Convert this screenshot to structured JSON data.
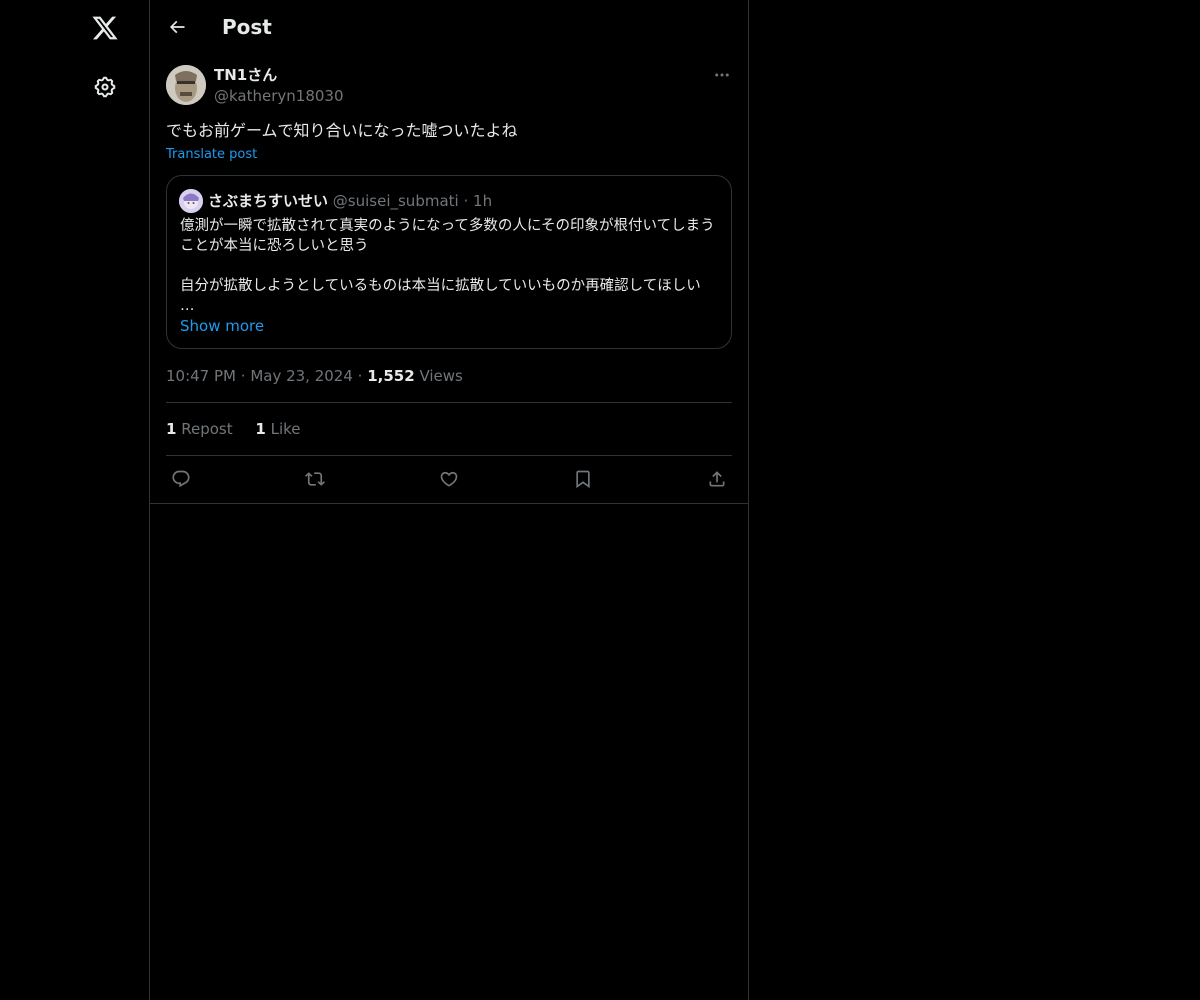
{
  "header": {
    "title": "Post"
  },
  "sidebar": {
    "items": [
      {
        "icon": "x-logo-icon"
      },
      {
        "icon": "gear-icon"
      }
    ]
  },
  "post": {
    "author_name": "TN1さん",
    "author_handle": "@katheryn18030",
    "text": "でもお前ゲームで知り合いになった嘘ついたよね",
    "translate_label": "Translate post",
    "time": "10:47 PM",
    "date": "May 23, 2024",
    "views_count": "1,552",
    "views_label": "Views",
    "reposts_count": "1",
    "reposts_label": "Repost",
    "likes_count": "1",
    "likes_label": "Like"
  },
  "quote": {
    "name": "さぶまちすいせい",
    "handle": "@suisei_submati",
    "age": "1h",
    "line1": "億測が一瞬で拡散されて真実のようになって多数の人にその印象が根付いてしまうことが本当に恐ろしいと思う",
    "line2": "自分が拡散しようとしているものは本当に拡散していいものか再確認してほしい",
    "ellipsis": "…",
    "show_more": "Show more"
  },
  "colors": {
    "background": "#000000",
    "text": "#e7e9ea",
    "muted": "#71767b",
    "accent": "#1d9bf0",
    "border": "#2f3336"
  }
}
